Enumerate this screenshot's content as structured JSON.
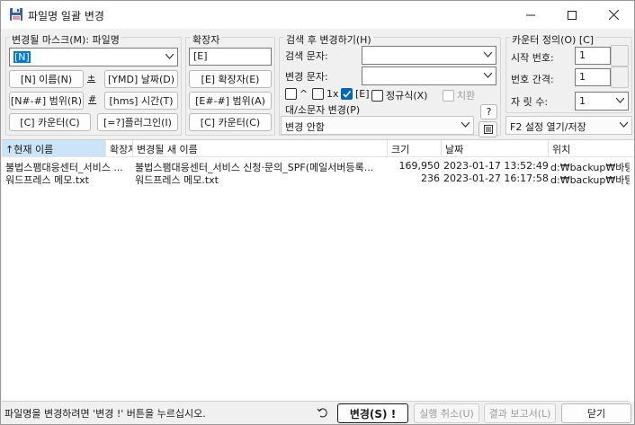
{
  "window": {
    "title": "파일명 일괄 변경"
  },
  "mask": {
    "label": "변경될 마스크(M): 파일명",
    "value": "[N]",
    "buttons": [
      "[N]  이름(N)",
      "±",
      "[YMD] 날짜(D)",
      "[N#-#] 범위(R)",
      "#",
      "[hms] 시간(T)",
      "[C] 카운터(C)",
      "[=?]플러그인(I)"
    ]
  },
  "extension": {
    "label": "확장자",
    "value": "[E]",
    "buttons": [
      "[E]  확장자(E)",
      "[E#-#] 범위(A)",
      "[C] 카운터(C)"
    ]
  },
  "search": {
    "label": "검색 후 변경하기(H)",
    "search_label": "검색 문자:",
    "replace_label": "변경 문자:",
    "search_value": "",
    "replace_value": "",
    "options": [
      {
        "label": "^",
        "checked": false,
        "enabled": true
      },
      {
        "label": "1x",
        "checked": false,
        "enabled": true
      },
      {
        "label": "[E]",
        "checked": true,
        "enabled": true
      },
      {
        "label": "정규식(X)",
        "checked": false,
        "enabled": true
      },
      {
        "label": "치환",
        "checked": false,
        "enabled": false
      }
    ],
    "case_label": "대/소문자 변경(P)",
    "case_value": "변경 안함",
    "help_label": "?"
  },
  "counter": {
    "label": "카운터 정의(O) [C]",
    "start_label": "시작 번호:",
    "start_value": "1",
    "step_label": "번호 간격:",
    "step_value": "1",
    "digits_label": "자 릿 수:",
    "digits_value": "1",
    "settings_value": "F2 설정 열기/저장"
  },
  "table": {
    "columns": [
      "현재 이름",
      "확장자",
      "변경될 새 이름",
      "크기",
      "날짜",
      "위치"
    ],
    "sort_indicator": "↑",
    "rows": [
      {
        "name": "불법스팸대응센터_서비스 ...",
        "ext": "",
        "new_name": "불법스팸대응센터_서비스 신청·문의_SPF(메일서버등록...",
        "size": "169,950",
        "date": "2023-01-17 13:52:49",
        "location": "d:₩backup₩바탕화"
      },
      {
        "name": "워드프레스 메모.txt",
        "ext": "",
        "new_name": "워드프레스 메모.txt",
        "size": "236",
        "date": "2023-01-27 16:17:58",
        "location": "d:₩backup₩바탕화"
      }
    ]
  },
  "footer": {
    "status": "파일명을 변경하려면 '변경 !' 버튼을 누르십시오.",
    "undo_icon": "undo-icon",
    "rename_label": "변경(S) !",
    "cancel_label": "실행 취소(U)",
    "report_label": "결과 보고서(L)",
    "close_label": "닫기"
  },
  "colors": {
    "accent": "#0078d7",
    "header_active": "#cce4f7",
    "checkbox_on": "#0067c0"
  }
}
